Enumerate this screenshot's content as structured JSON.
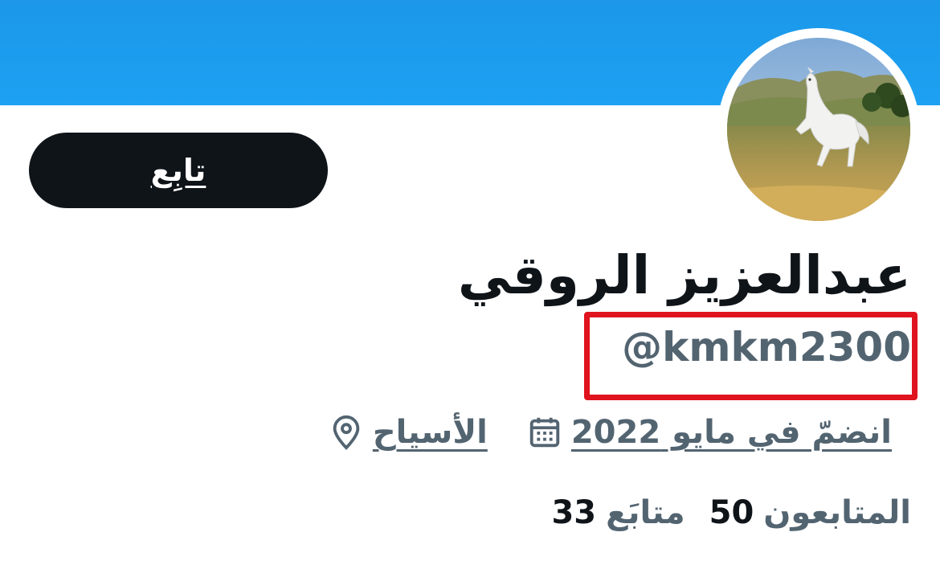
{
  "profile": {
    "display_name": "عبدالعزيز الروقي",
    "handle": "@kmkm2300",
    "follow_label": "تابِع",
    "location": "الأسياح",
    "joined": "انضمّ في مايو 2022",
    "following_count": "33",
    "following_label": "متابَع",
    "followers_count": "50",
    "followers_label": "المتابعون"
  },
  "icons": {
    "location": "location-pin-icon",
    "calendar": "calendar-icon"
  },
  "colors": {
    "banner": "#1da1f2",
    "follow_button": "#0f1419",
    "secondary_text": "#536471",
    "highlight_box": "#e0141e"
  }
}
